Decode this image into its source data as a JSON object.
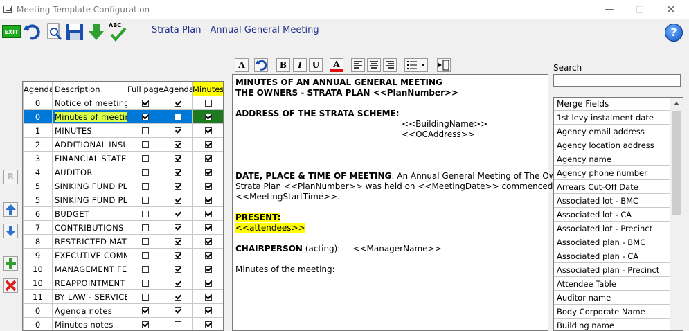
{
  "window": {
    "title": "Meeting Template Configuration"
  },
  "toolbar": {
    "exit_label": "EXIT",
    "spell_label": "ABC",
    "plan_title": "Strata Plan - Annual General Meeting",
    "help_label": "?"
  },
  "side_buttons": {
    "reset_label": "R"
  },
  "grid": {
    "headers": [
      "Agenda",
      "Description",
      "Full page",
      "Agenda",
      "Minutes"
    ],
    "rows": [
      {
        "agenda": "0",
        "description": "Notice of meeting",
        "full_page": true,
        "agenda_cb": true,
        "minutes": false
      },
      {
        "agenda": "0",
        "description": "Minutes of meeting",
        "full_page": true,
        "agenda_cb": false,
        "minutes": true,
        "selected": true
      },
      {
        "agenda": "1",
        "description": "MINUTES",
        "full_page": false,
        "agenda_cb": true,
        "minutes": true
      },
      {
        "agenda": "2",
        "description": "ADDITIONAL INSUR",
        "full_page": false,
        "agenda_cb": true,
        "minutes": true
      },
      {
        "agenda": "3",
        "description": "FINANCIAL STATEM",
        "full_page": false,
        "agenda_cb": true,
        "minutes": true
      },
      {
        "agenda": "4",
        "description": "AUDITOR",
        "full_page": false,
        "agenda_cb": true,
        "minutes": true
      },
      {
        "agenda": "5",
        "description": "SINKING FUND PLA",
        "full_page": false,
        "agenda_cb": true,
        "minutes": true
      },
      {
        "agenda": "5",
        "description": "SINKING FUND PLA",
        "full_page": false,
        "agenda_cb": true,
        "minutes": true
      },
      {
        "agenda": "6",
        "description": "BUDGET",
        "full_page": false,
        "agenda_cb": true,
        "minutes": true
      },
      {
        "agenda": "7",
        "description": "CONTRIBUTIONS",
        "full_page": false,
        "agenda_cb": true,
        "minutes": true
      },
      {
        "agenda": "8",
        "description": "RESTRICTED MATT",
        "full_page": false,
        "agenda_cb": true,
        "minutes": true
      },
      {
        "agenda": "9",
        "description": "EXECUTIVE COMMI",
        "full_page": false,
        "agenda_cb": true,
        "minutes": true
      },
      {
        "agenda": "10",
        "description": "MANAGEMENT FEE",
        "full_page": false,
        "agenda_cb": true,
        "minutes": true
      },
      {
        "agenda": "10",
        "description": "REAPPOINTMENT C",
        "full_page": false,
        "agenda_cb": true,
        "minutes": true
      },
      {
        "agenda": "11",
        "description": "BY LAW - SERVICE",
        "full_page": false,
        "agenda_cb": true,
        "minutes": true
      },
      {
        "agenda": "0",
        "description": "Agenda notes",
        "full_page": true,
        "agenda_cb": true,
        "minutes": true
      },
      {
        "agenda": "0",
        "description": "Minutes notes",
        "full_page": true,
        "agenda_cb": false,
        "minutes": true
      }
    ]
  },
  "editor_toolbar": {
    "font_label": "A",
    "bold_label": "B",
    "italic_label": "I",
    "underline_label": "U",
    "color_label": "A"
  },
  "editor": {
    "line1": "MINUTES OF AN ANNUAL GENERAL MEETING",
    "line2": "THE OWNERS - STRATA PLAN <<PlanNumber>>",
    "address_heading": "ADDRESS OF THE STRATA SCHEME:",
    "building_name": "<<BuildingName>>",
    "oc_address": "<<OCAddress>>",
    "date_heading": "DATE, PLACE & TIME OF MEETING",
    "date_text1": ": An Annual General Meeting of The Owners -",
    "date_text2": "Strata Plan <<PlanNumber>> was held on <<MeetingDate>> commenced at",
    "date_text3": "<<MeetingStartTime>>.",
    "present_heading": "PRESENT:",
    "attendees": "<<attendees>>",
    "chair_heading": "CHAIRPERSON",
    "chair_acting": " (acting):",
    "manager_name": "<<ManagerName>>",
    "minutes_line": "Minutes of the meeting:"
  },
  "search": {
    "label": "Search",
    "value": ""
  },
  "merge_fields": {
    "header": "Merge Fields",
    "items": [
      "1st levy instalment date",
      "Agency email address",
      "Agency location address",
      "Agency name",
      "Agency phone number",
      "Arrears Cut-Off Date",
      "Associated lot - BMC",
      "Associated lot - CA",
      "Associated lot - Precinct",
      "Associated plan - BMC",
      "Associated plan - CA",
      "Associated plan - Precinct",
      "Attendee Table",
      "Auditor name",
      "Body Corporate Name",
      "Building name"
    ]
  }
}
